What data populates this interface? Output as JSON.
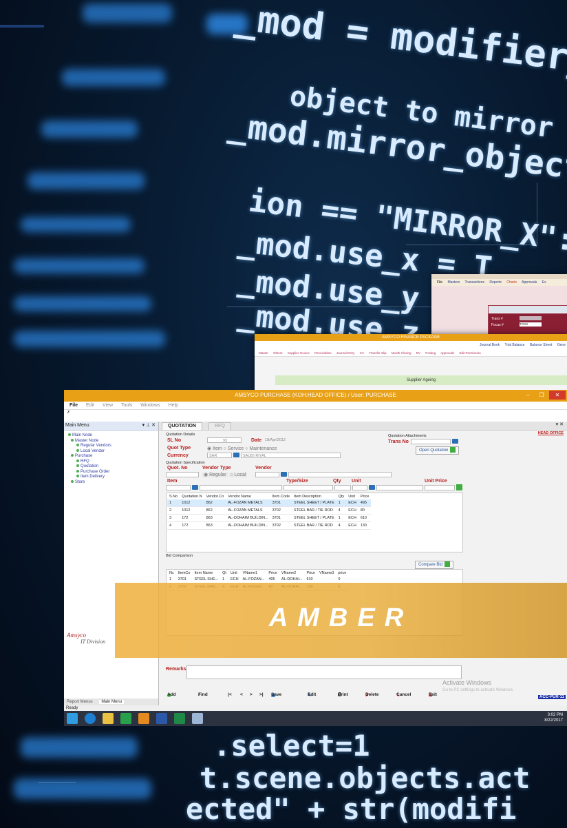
{
  "background": {
    "code_lines": [
      "_mod = modifier_ob.",
      "object to mirror",
      "_mod.mirror_object",
      "ion == \"MIRROR_X\":",
      "_mod.use_x = T",
      "_mod.use_y",
      "_mod.use_z",
      ".select=1",
      "t.scene.objects.act",
      "ected\" + str(modifi"
    ]
  },
  "back_window_1": {
    "menu": [
      "File",
      "Masters",
      "Transactions",
      "Reports",
      "Charts",
      "Approvals",
      "Ex"
    ],
    "fields": [
      "Trans #",
      "Focus #"
    ],
    "field_value": "TGSS"
  },
  "back_window_2": {
    "title": "AMSYCO FINANCE PACKAGE",
    "toolbar": [
      "Journal Book",
      "Trial Balance",
      "Balance Sheet",
      "Gene"
    ],
    "menu": [
      "Master",
      "Others",
      "Supplier Invoice",
      "Receivables",
      "Journal Entry",
      "CV",
      "Transfer Slip",
      "Month Closing",
      "RV",
      "Posting",
      "Approvals",
      "Edit Permission"
    ],
    "panel_title": "Supplier Ageing"
  },
  "window": {
    "title": "AMSYCO PURCHASE (KOH:HEAD OFFICE) / User: PURCHASE",
    "menu": [
      "File",
      "Edit",
      "View",
      "Tools",
      "Windows",
      "Help"
    ],
    "status": "Ready",
    "activate_title": "Activate Windows",
    "activate_sub": "Go to PC settings to activate Windows.",
    "badge": "ACC-PUR-11",
    "clock_time": "3:02 PM",
    "clock_date": "8/22/2017"
  },
  "sidebar": {
    "title": "Main Menu",
    "tree": [
      "Main Node",
      "Master Node",
      "Regular Vendors",
      "Local Vendor",
      "Purchase",
      "RFQ",
      "Quotation",
      "Purchase Order",
      "Item Delivery",
      "Store"
    ],
    "company": "Amsyco",
    "division": "IT Division",
    "bottom_tabs": [
      "Report Menus",
      "Main Menu"
    ]
  },
  "tabs": [
    "QUOTATION",
    "RFQ"
  ],
  "head_office": "HEAD OFFICE",
  "quotation": {
    "details_label": "Quotation Details",
    "sl_label": "SL No",
    "sl_value": "93",
    "date_label": "Date",
    "date_value": "18/Apr/2012",
    "quot_type_label": "Quot Type",
    "quot_types": [
      "Item",
      "Service",
      "Maintenance"
    ],
    "currency_label": "Currency",
    "currency_code": "SAR",
    "currency_name": "SAUDI RIYAL",
    "attach_label": "Quotation Attachments",
    "trans_label": "Trans No",
    "open_btn": "Open Quotation",
    "spec_label": "Quotation Specification",
    "quot_no_label": "Quot. No",
    "vendor_type_label": "Vendor Type",
    "vendor_types": [
      "Regular",
      "Local"
    ],
    "vendor_label": "Vendor",
    "item_label": "Item",
    "type_size_label": "Type/Size",
    "qty_label": "Qty",
    "unit_label": "Unit",
    "unit_price_label": "Unit Price",
    "grid_headers": [
      "S.No",
      "Quotation.N",
      "Vendor.Co",
      "Vendor Name",
      "Item.Code",
      "Item Description",
      "Qty",
      "Unit",
      "Price"
    ],
    "grid_rows": [
      [
        "1",
        "1012",
        "862",
        "AL-FOZAN METALS",
        "3701",
        "STEEL SHEET / PLATE",
        "1",
        "ECH",
        "495"
      ],
      [
        "2",
        "1012",
        "862",
        "AL-FOZAN METALS",
        "3702",
        "STEEL BAR / TIE ROD",
        "4",
        "ECH",
        "80"
      ],
      [
        "3",
        "172",
        "863",
        "AL-DOHAIM BUILDIN...",
        "3701",
        "STEEL SHEET / PLATE",
        "1",
        "ECH",
        "610"
      ],
      [
        "4",
        "172",
        "863",
        "AL-DOHAIM BUILDIN...",
        "3702",
        "STEEL BAR / TIE ROD",
        "4",
        "ECH",
        "130"
      ]
    ],
    "bid_label": "Bid Comparison",
    "compare_btn": "Compare Bid",
    "bid_headers": [
      "Nc",
      "ItemCo",
      "Item Name",
      "Qt",
      "Unit",
      "VName1",
      "Price",
      "VName2",
      "Price",
      "VName3",
      "price"
    ],
    "bid_rows": [
      [
        "1",
        "3701",
        "STEEL SHE...",
        "1",
        "ECH",
        "AL-FOZAN...",
        "495",
        "AL-DOHAI...",
        "610",
        "",
        "0"
      ],
      [
        "2",
        "3702",
        "STEEL BAR...",
        "4",
        "ECH",
        "AL-FOZAN...",
        "80",
        "AL-DOHAI...",
        "130",
        "",
        "0"
      ]
    ],
    "remarks_label": "Remarks"
  },
  "actions": [
    "Add",
    "Find",
    "|<",
    "<",
    ">",
    ">|",
    "Save",
    "Edit",
    "Print",
    "Delete",
    "Cancel",
    "Exit"
  ],
  "banner": {
    "text": "AMBER"
  },
  "colors": {
    "title_bar": "#e8a016",
    "accent_red": "#b61c1c",
    "banner": "#eaa834",
    "taskbar": "#2d3240"
  }
}
